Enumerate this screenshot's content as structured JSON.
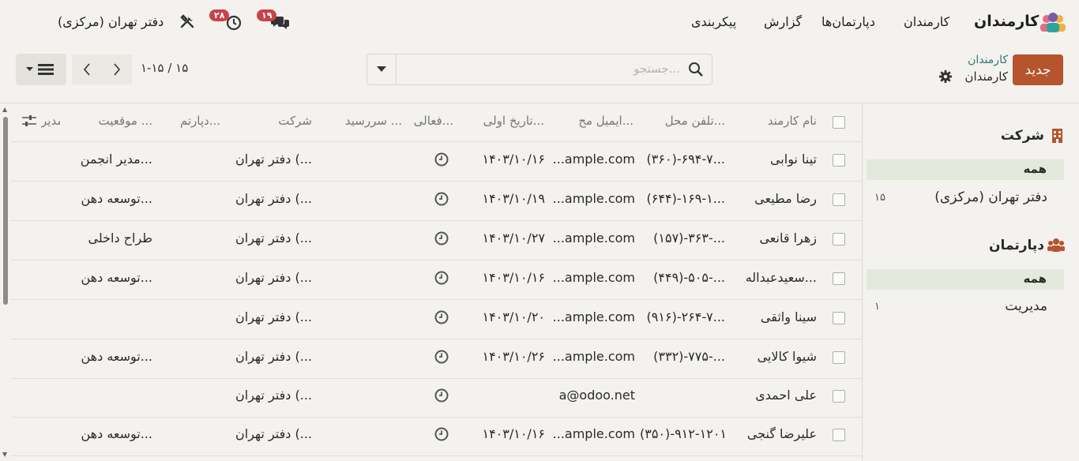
{
  "app": {
    "name": "کارمندان",
    "menu": [
      "کارمندان",
      "دپارتمان‌ها",
      "گزارش",
      "پیکربندی"
    ],
    "company": "دفتر تهران (مرکزی)",
    "messages_badge": "۱۹",
    "activity_badge": "۲۸"
  },
  "control": {
    "new_label": "جدید",
    "breadcrumb_parent": "کارمندان",
    "breadcrumb_current": "کارمندان",
    "search_placeholder": "جستجو...",
    "pager": "۱-۱۵ / ۱۵"
  },
  "table": {
    "headers": [
      "نام کارمند",
      "تلفن محل...",
      "ایمیل مح...",
      "تاریخ اولی...",
      "فعالی...",
      "سررسید ...",
      "شرکت",
      "دپارتم...",
      "موقعیت ...",
      "مدیر"
    ],
    "rows": [
      {
        "name": "تینا نوابی",
        "phone": "(۳۶۰)-۶۹۴-۷...",
        "email": "...ample.com",
        "date": "۱۴۰۳/۱۰/۱۶",
        "company": "دفتر تهران (...",
        "job": "مدیر انجمن..."
      },
      {
        "name": "رضا مطیعی",
        "phone": "(۶۴۴)-۱۶۹-۱...",
        "email": "...ample.com",
        "date": "۱۴۰۳/۱۰/۱۹",
        "company": "دفتر تهران (...",
        "job": "توسعه دهن..."
      },
      {
        "name": "زهرا قانعی",
        "phone": "(۱۵۷)-۳۶۳-...",
        "email": "...ample.com",
        "date": "۱۴۰۳/۱۰/۲۷",
        "company": "دفتر تهران (...",
        "job": "طراح داخلی"
      },
      {
        "name": "سعیدعبداله...",
        "phone": "(۴۴۹)-۵۰۵-...",
        "email": "...ample.com",
        "date": "۱۴۰۳/۱۰/۱۶",
        "company": "دفتر تهران (...",
        "job": "توسعه دهن..."
      },
      {
        "name": "سینا واثقی",
        "phone": "(۹۱۶)-۲۶۴-۷...",
        "email": "...ample.com",
        "date": "۱۴۰۳/۱۰/۲۰",
        "company": "دفتر تهران (...",
        "job": ""
      },
      {
        "name": "شیوا کالایی",
        "phone": "(۳۳۲)-۷۷۵-...",
        "email": "...ample.com",
        "date": "۱۴۰۳/۱۰/۲۶",
        "company": "دفتر تهران (...",
        "job": "توسعه دهن..."
      },
      {
        "name": "علی احمدی",
        "phone": "",
        "email": "a@odoo.net",
        "date": "",
        "company": "دفتر تهران (...",
        "job": ""
      },
      {
        "name": "علیرضا گنجی",
        "phone": "(۳۵۰)-۹۱۲-۱۲۰۱",
        "email": "...ample.com",
        "date": "۱۴۰۳/۱۰/۱۶",
        "company": "دفتر تهران (...",
        "job": "توسعه دهن..."
      }
    ]
  },
  "sidebar": {
    "company_title": "شرکت",
    "company_all": "همه",
    "company_item": "دفتر تهران (مرکزی)",
    "company_count": "۱۵",
    "dept_title": "دپارتمان",
    "dept_all": "همه",
    "dept_item": "مدیریت",
    "dept_count": "۱"
  }
}
